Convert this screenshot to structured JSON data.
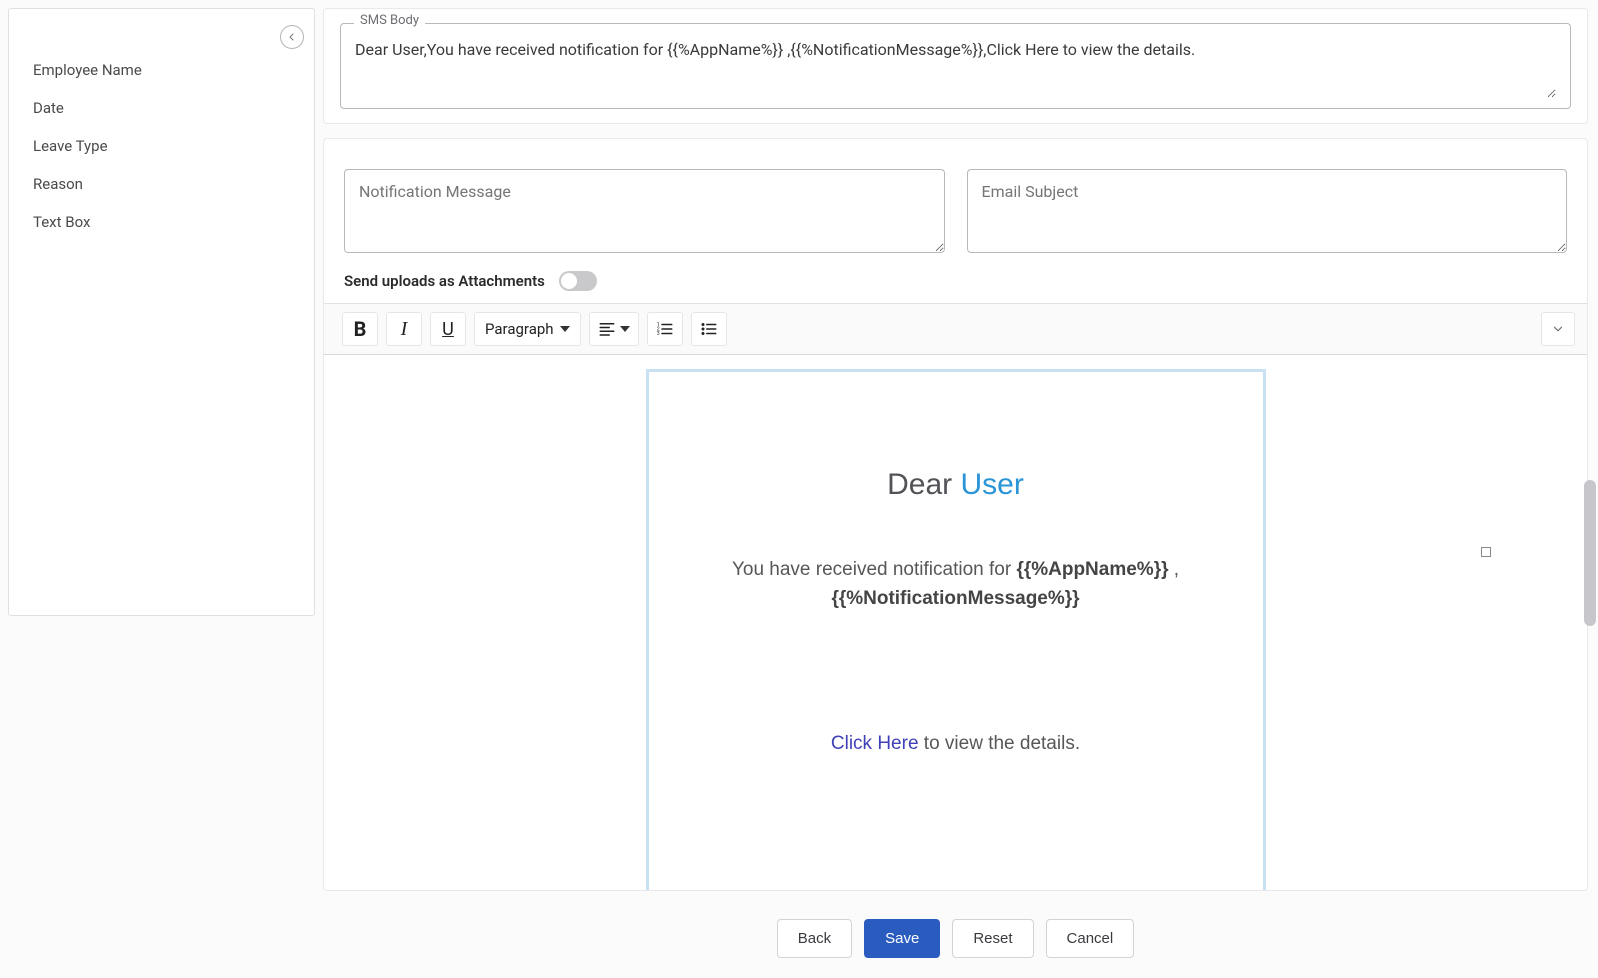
{
  "sidebar": {
    "items": [
      {
        "label": "Employee Name"
      },
      {
        "label": "Date"
      },
      {
        "label": "Leave Type"
      },
      {
        "label": "Reason"
      },
      {
        "label": "Text Box"
      }
    ]
  },
  "sms": {
    "legend": "SMS Body",
    "body": "Dear User,You have received notification for {{%AppName%}} ,{{%NotificationMessage%}},Click Here to view the details."
  },
  "notif": {
    "message_placeholder": "Notification Message",
    "subject_placeholder": "Email Subject",
    "attach_label": "Send uploads as Attachments"
  },
  "rte": {
    "para_label": "Paragraph"
  },
  "editor": {
    "greeting_prefix": "Dear ",
    "greeting_user": "User",
    "body_prefix": "You have received notification for ",
    "token_app": "{{%AppName%}}",
    "body_sep": " , ",
    "token_msg": "{{%NotificationMessage%}}",
    "click_link": "Click Here",
    "click_suffix": " to view the details."
  },
  "footer": {
    "back": "Back",
    "save": "Save",
    "reset": "Reset",
    "cancel": "Cancel"
  }
}
